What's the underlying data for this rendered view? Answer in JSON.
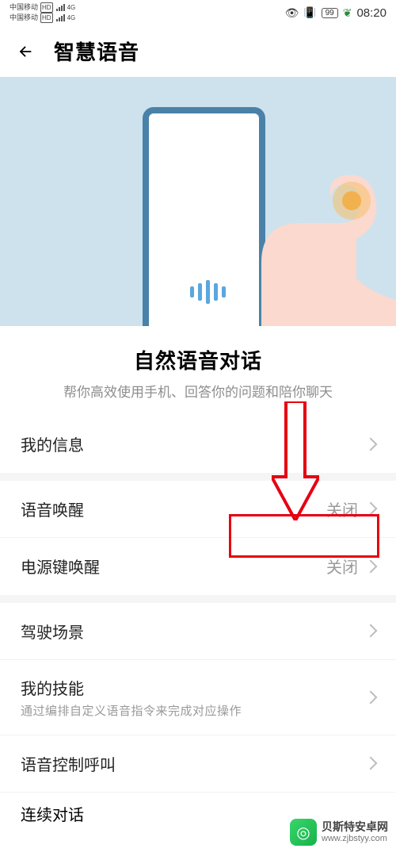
{
  "status": {
    "carrier": "中国移动",
    "net1": "HD",
    "net2": "4G",
    "battery": "99",
    "time": "08:20"
  },
  "header": {
    "title": "智慧语音"
  },
  "hero": {
    "section_title": "自然语音对话",
    "section_desc": "帮你高效使用手机、回答你的问题和陪你聊天"
  },
  "rows": {
    "my_info": "我的信息",
    "voice_wake": "语音唤醒",
    "voice_wake_value": "关闭",
    "power_wake": "电源键唤醒",
    "power_wake_value": "关闭",
    "driving": "驾驶场景",
    "skills": "我的技能",
    "skills_sub": "通过编排自定义语音指令来完成对应操作",
    "voice_call": "语音控制呼叫",
    "continuous": "连续对话"
  },
  "watermark": {
    "brand": "贝斯特安卓网",
    "url": "www.zjbstyy.com"
  }
}
